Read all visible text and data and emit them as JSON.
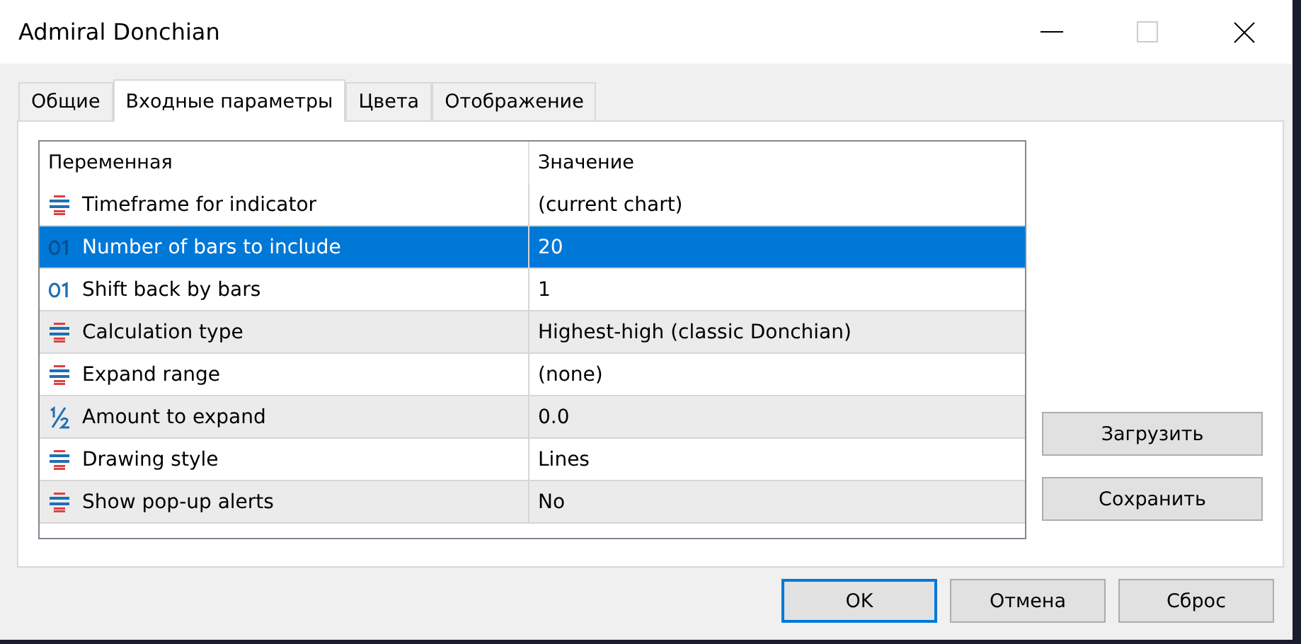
{
  "window": {
    "title": "Admiral Donchian"
  },
  "tabs": [
    {
      "label": "Общие",
      "selected": false
    },
    {
      "label": "Входные параметры",
      "selected": true
    },
    {
      "label": "Цвета",
      "selected": false
    },
    {
      "label": "Отображение",
      "selected": false
    }
  ],
  "table": {
    "columns": [
      "Переменная",
      "Значение"
    ],
    "rows": [
      {
        "kind": "enum",
        "name": "Timeframe for indicator",
        "value": "(current chart)",
        "selected": false
      },
      {
        "kind": "int",
        "name": "Number of bars to include",
        "value": "20",
        "selected": true
      },
      {
        "kind": "int",
        "name": "Shift back by bars",
        "value": "1",
        "selected": false
      },
      {
        "kind": "enum",
        "name": "Calculation type",
        "value": "Highest-high (classic Donchian)",
        "selected": false
      },
      {
        "kind": "enum",
        "name": "Expand range",
        "value": "(none)",
        "selected": false
      },
      {
        "kind": "double",
        "name": "Amount to expand",
        "value": "0.0",
        "selected": false
      },
      {
        "kind": "enum",
        "name": "Drawing style",
        "value": "Lines",
        "selected": false
      },
      {
        "kind": "enum",
        "name": "Show pop-up alerts",
        "value": "No",
        "selected": false
      }
    ]
  },
  "side_buttons": [
    "Загрузить",
    "Сохранить"
  ],
  "buttons": [
    {
      "label": "OK",
      "default": true
    },
    {
      "label": "Отмена",
      "default": false
    },
    {
      "label": "Сброс",
      "default": false
    }
  ]
}
